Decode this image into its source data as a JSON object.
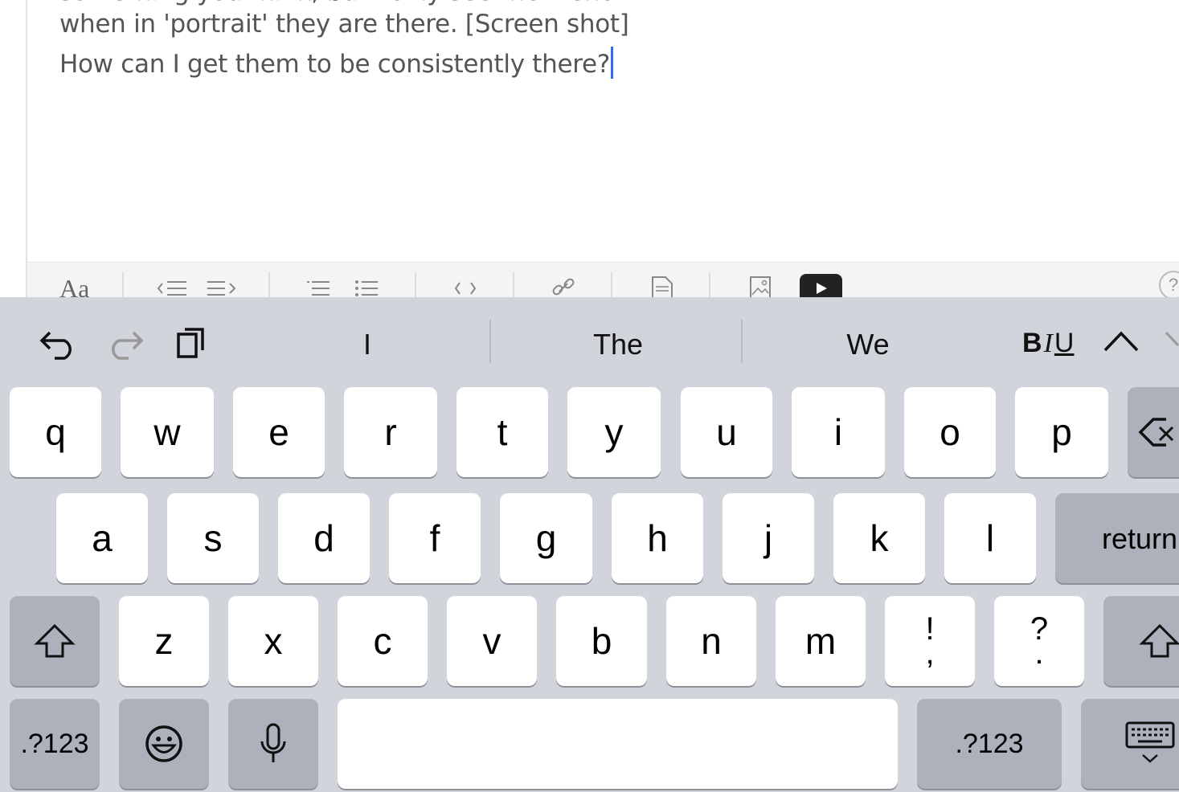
{
  "editor": {
    "line0": "something you think, but I only see them shown",
    "line1": "when in 'portrait' they are there. [Screen shot]",
    "line2": "How can I get them to be consistently there?"
  },
  "format_toolbar": {
    "font_button": "Aa",
    "items": [
      "outdent-icon",
      "indent-icon",
      "numbered-list-icon",
      "bullet-list-icon",
      "code-icon",
      "link-icon",
      "document-icon",
      "image-icon",
      "video-icon",
      "help-icon"
    ]
  },
  "keyboard": {
    "suggestions": [
      "I",
      "The",
      "We"
    ],
    "format_labels": {
      "bold": "B",
      "italic": "I",
      "underline": "U"
    },
    "row1": [
      "q",
      "w",
      "e",
      "r",
      "t",
      "y",
      "u",
      "i",
      "o",
      "p"
    ],
    "row2": [
      "a",
      "s",
      "d",
      "f",
      "g",
      "h",
      "j",
      "k",
      "l"
    ],
    "row2_return": "return",
    "row3": [
      "z",
      "x",
      "c",
      "v",
      "b",
      "n",
      "m"
    ],
    "row3_punct": [
      {
        "top": "!",
        "bottom": ","
      },
      {
        "top": "?",
        "bottom": "."
      }
    ],
    "row4": {
      "num_left": ".?123",
      "num_right": ".?123"
    },
    "colors": {
      "background": "#d1d4db",
      "key": "#ffffff",
      "dark_key": "#acb1bb",
      "caret": "#2f6cf6"
    }
  }
}
